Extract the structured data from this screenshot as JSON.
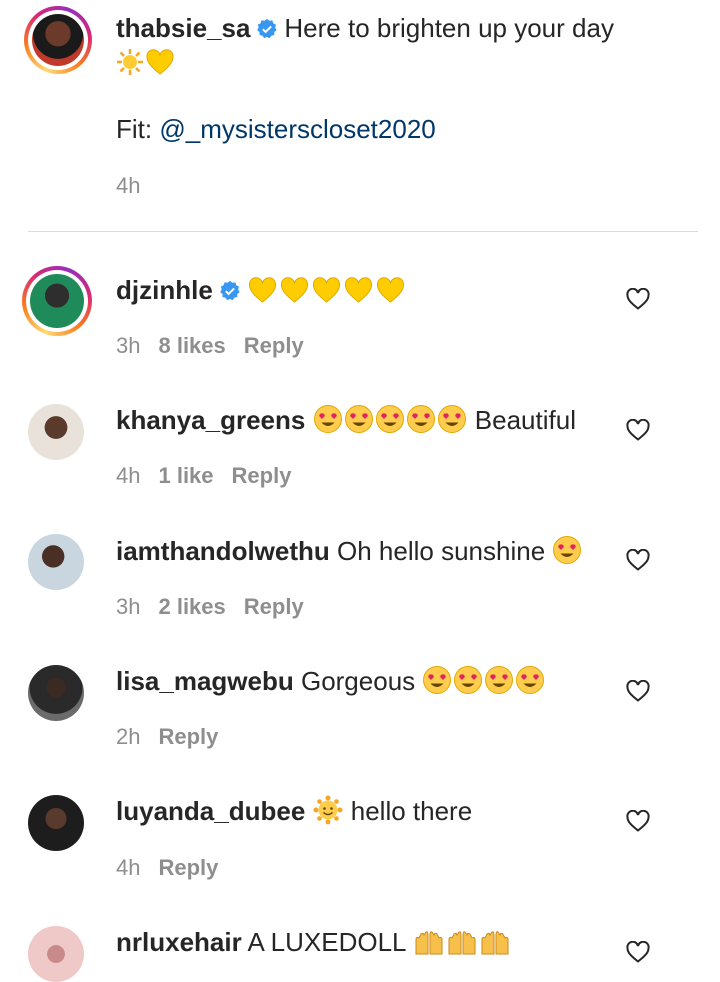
{
  "caption": {
    "username": "thabsie_sa",
    "text": "Here to brighten up your day",
    "emojis": [
      "sun",
      "yellow-heart"
    ],
    "fit_label": "Fit:",
    "fit_mention": "@_mysisterscloset2020",
    "time": "4h",
    "verified": true
  },
  "comments": [
    {
      "username": "djzinhle",
      "verified": true,
      "text": "",
      "emojis": [
        "yellow-heart",
        "yellow-heart",
        "yellow-heart",
        "yellow-heart",
        "yellow-heart"
      ],
      "time": "3h",
      "likes": "8 likes",
      "reply": "Reply"
    },
    {
      "username": "khanya_greens",
      "verified": false,
      "text": "Beautiful",
      "emojis": [
        "heart-eyes",
        "heart-eyes",
        "heart-eyes",
        "heart-eyes",
        "heart-eyes"
      ],
      "time": "4h",
      "likes": "1 like",
      "reply": "Reply"
    },
    {
      "username": "iamthandolwethu",
      "verified": false,
      "text": "Oh hello sunshine",
      "emojis": [
        "heart-eyes"
      ],
      "time": "3h",
      "likes": "2 likes",
      "reply": "Reply"
    },
    {
      "username": "lisa_magwebu",
      "verified": false,
      "text": "Gorgeous",
      "emojis": [
        "heart-eyes",
        "heart-eyes",
        "heart-eyes",
        "heart-eyes"
      ],
      "time": "2h",
      "likes": "",
      "reply": "Reply"
    },
    {
      "username": "luyanda_dubee",
      "verified": false,
      "text": "hello there",
      "emojis": [
        "sun-face"
      ],
      "time": "4h",
      "likes": "",
      "reply": "Reply"
    },
    {
      "username": "nrluxehair",
      "verified": false,
      "text": "A LUXEDOLL",
      "emojis": [
        "raising-hands",
        "raising-hands",
        "raising-hands"
      ],
      "time": "",
      "likes": "",
      "reply": ""
    }
  ],
  "colors": {
    "text": "#262626",
    "meta": "#8e8e8e",
    "link": "#00376b",
    "verified": "#3897f0"
  }
}
